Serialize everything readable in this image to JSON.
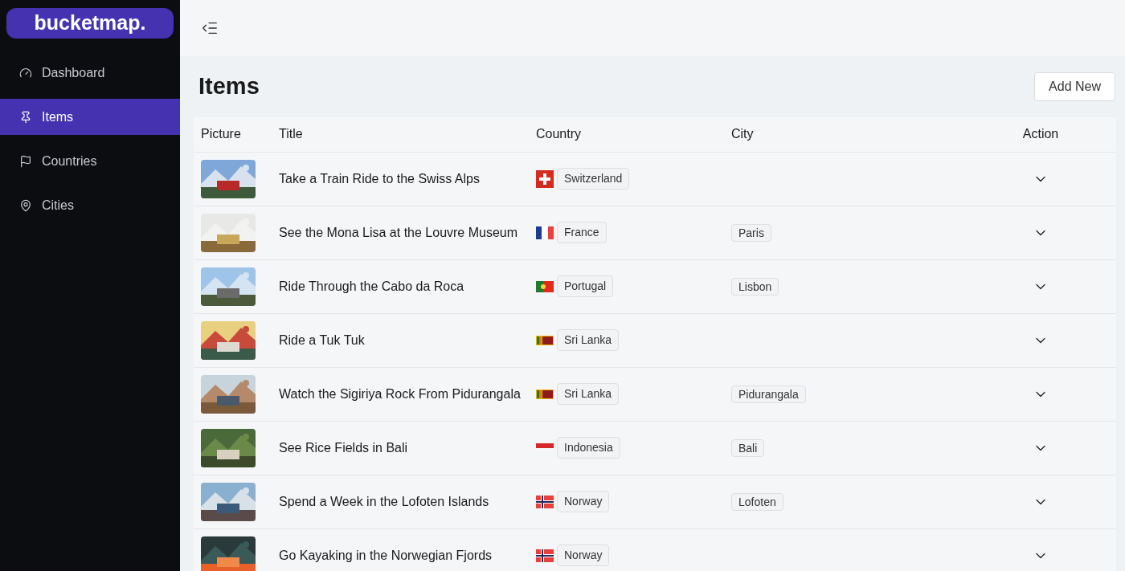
{
  "sidebar": {
    "logo": "bucketmap.",
    "items": [
      {
        "label": "Dashboard",
        "selected": false
      },
      {
        "label": "Items",
        "selected": true
      },
      {
        "label": "Countries",
        "selected": false
      },
      {
        "label": "Cities",
        "selected": false
      }
    ]
  },
  "page": {
    "title": "Items",
    "add_button": "Add New"
  },
  "table": {
    "columns": [
      "Picture",
      "Title",
      "Country",
      "City",
      "Action"
    ],
    "rows": [
      {
        "title": "Take a Train Ride to the Swiss Alps",
        "country": {
          "kind": "switzerland",
          "name": "Switzerland"
        }
      },
      {
        "title": "See the Mona Lisa at the Louvre Museum",
        "country": {
          "kind": "france",
          "name": "France"
        },
        "city": "Paris"
      },
      {
        "title": "Ride Through the Cabo da Roca",
        "country": {
          "kind": "portugal",
          "name": "Portugal"
        },
        "city": "Lisbon"
      },
      {
        "title": "Ride a Tuk Tuk",
        "country": {
          "kind": "srilanka",
          "name": "Sri Lanka"
        }
      },
      {
        "title": "Watch the Sigiriya Rock From Pidurangala",
        "country": {
          "kind": "srilanka",
          "name": "Sri Lanka"
        },
        "city": "Pidurangala"
      },
      {
        "title": "See Rice Fields in Bali",
        "country": {
          "kind": "indonesia",
          "name": "Indonesia"
        },
        "city": "Bali"
      },
      {
        "title": "Spend a Week in the Lofoten Islands",
        "country": {
          "kind": "norway",
          "name": "Norway"
        },
        "city": "Lofoten"
      },
      {
        "title": "Go Kayaking in the Norwegian Fjords",
        "country": {
          "kind": "norway",
          "name": "Norway"
        }
      }
    ]
  }
}
